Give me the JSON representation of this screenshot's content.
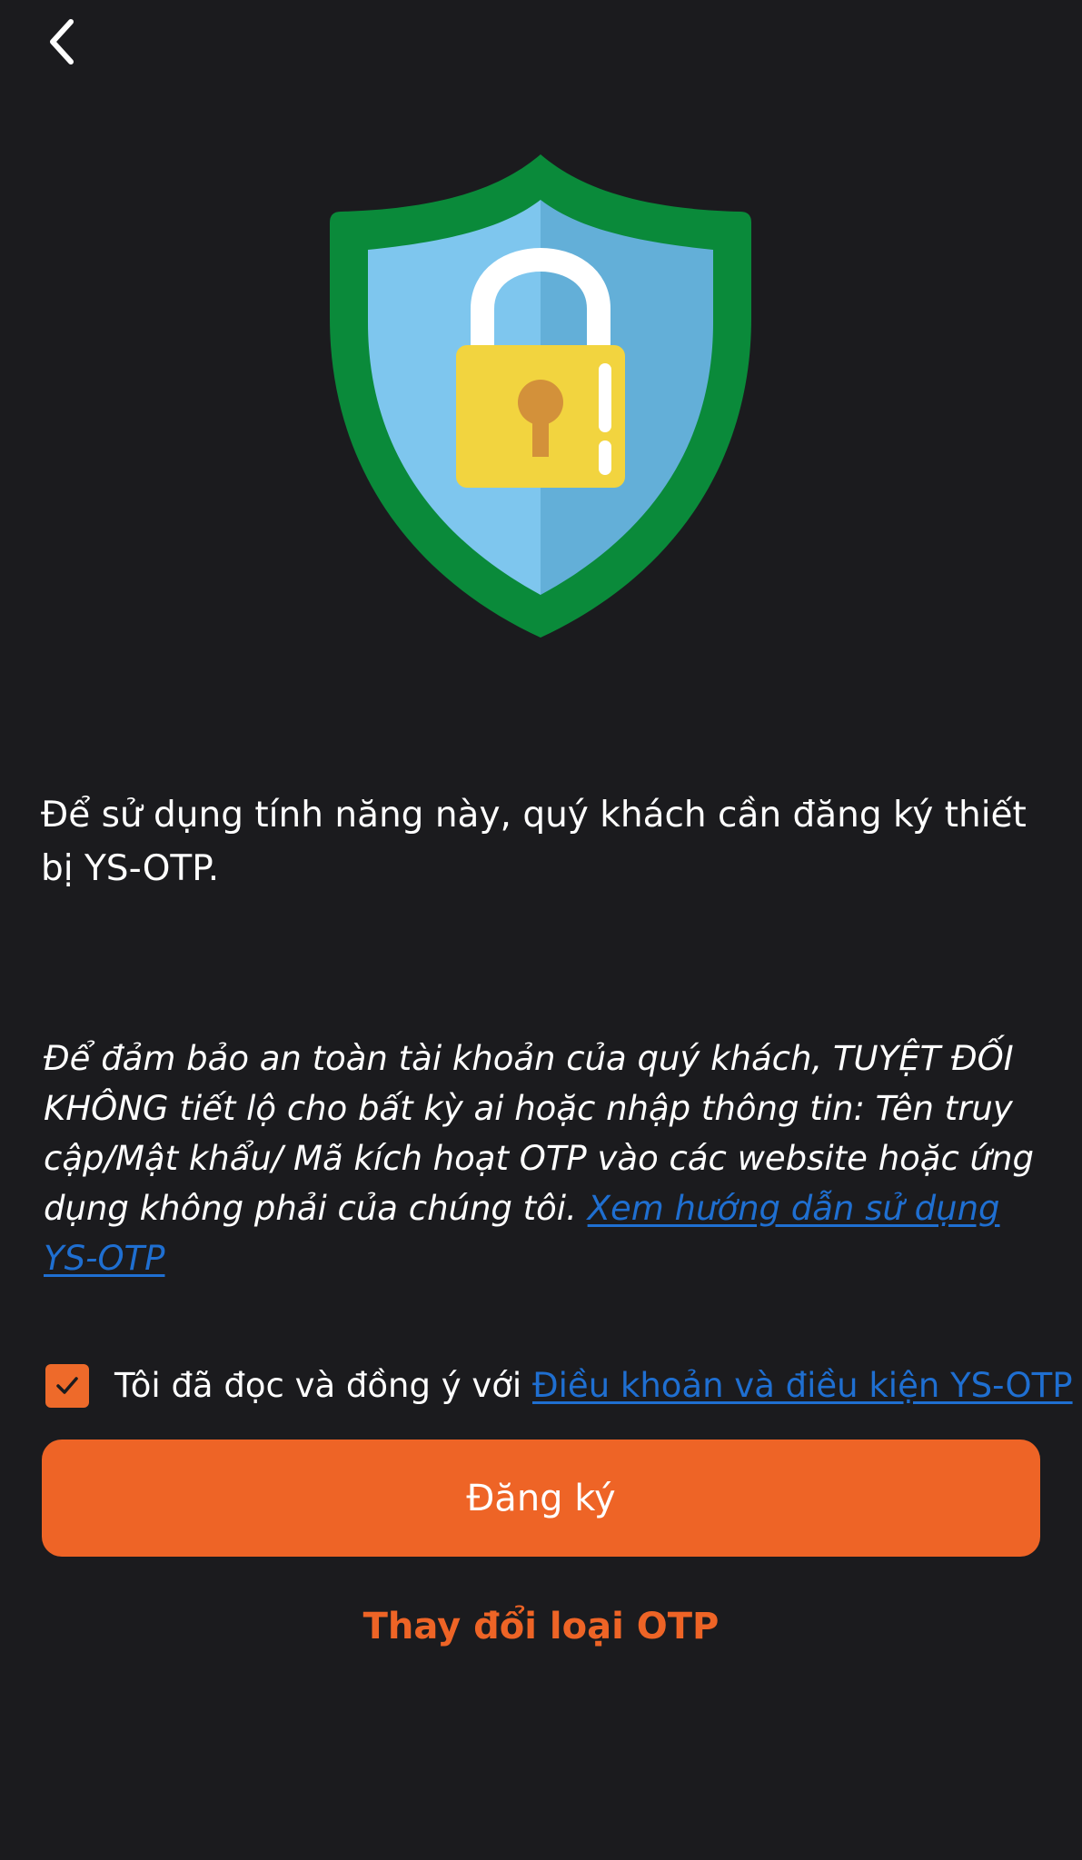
{
  "header": {
    "back_icon": "chevron-left-icon"
  },
  "hero": {
    "icon": "shield-lock-icon",
    "colors": {
      "shield_border": "#0a8a3a",
      "shield_left": "#7ec6ee",
      "shield_right": "#63afd8",
      "lock_body": "#f2d43f",
      "lock_shackle": "#ffffff",
      "keyhole": "#d3913a"
    }
  },
  "intro_text": "Để sử dụng tính năng này, quý khách cần đăng ký thiết bị YS-OTP.",
  "warning": {
    "text": "Để đảm bảo an toàn tài khoản của quý khách, TUYỆT ĐỐI KHÔNG tiết lộ cho bất kỳ ai hoặc nhập thông tin: Tên truy cập/Mật khẩu/ Mã kích hoạt OTP vào các website hoặc ứng dụng không phải của chúng tôi. ",
    "link_text": "Xem hướng dẫn sử dụng YS-OTP"
  },
  "agreement": {
    "checked": true,
    "check_icon": "checkmark-icon",
    "text": "Tôi đã đọc và đồng ý với ",
    "link_text": "Điều khoản và điều kiện YS-OTP"
  },
  "actions": {
    "register_label": "Đăng ký",
    "change_otp_label": "Thay đổi loại OTP"
  },
  "colors": {
    "background": "#1b1b1e",
    "accent": "#ee6426",
    "link": "#1f6fd1",
    "text": "#ffffff"
  }
}
